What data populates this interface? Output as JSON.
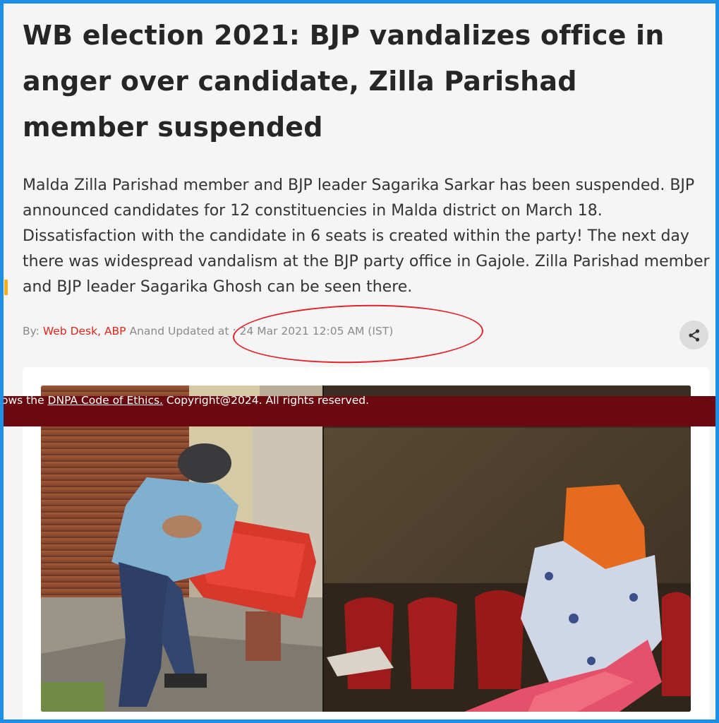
{
  "article": {
    "headline": "WB election 2021: BJP vandalizes office in anger over candidate, Zilla Parishad member suspended",
    "summary": "Malda Zilla Parishad member and BJP leader Sagarika Sarkar has been suspended. BJP announced candidates for 12 constituencies in Malda district on March 18. Dissatisfaction with the candidate in 6 seats is created within the party! The next day there was widespread vandalism at the BJP party office in Gajole. Zilla Parishad member and BJP leader Sagarika Ghosh can be seen there.",
    "byline": {
      "by_label": "By:",
      "author": "Web Desk, ABP",
      "author_suffix": "Anand",
      "updated_label": "Updated at :",
      "timestamp": "24 Mar 2021 12:05 AM (IST)"
    },
    "share_icon": "share-icon"
  },
  "footer_banner": {
    "prefix": "ows the",
    "link": "DNPA Code of Ethics.",
    "copyright": "Copyright@2024. All rights reserved."
  },
  "image": {
    "description_icon": "photo-collage"
  },
  "colors": {
    "author": "#e0261b",
    "banner_bg": "#6a0910",
    "annotation_circle": "#e0222b",
    "frame": "#1e8fe6"
  }
}
